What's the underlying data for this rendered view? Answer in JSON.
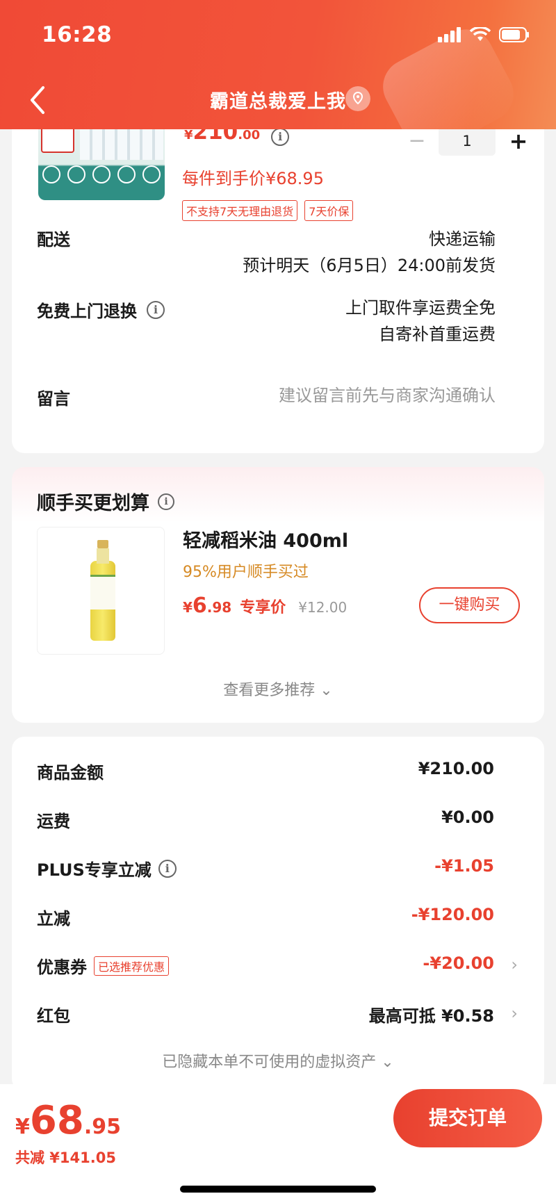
{
  "status_bar": {
    "time": "16:28"
  },
  "nav": {
    "title": "霸道总裁爱上我"
  },
  "product": {
    "price_currency": "¥",
    "price_int": "210",
    "price_dec": ".00",
    "quantity": "1",
    "each_price": "每件到手价¥68.95",
    "tags": [
      "不支持7天无理由退货",
      "7天价保"
    ]
  },
  "delivery": {
    "label": "配送",
    "method": "快递运输",
    "estimate": "预计明天（6月5日）24:00前发货"
  },
  "exchange": {
    "label": "免费上门退换",
    "line1": "上门取件享运费全免",
    "line2": "自寄补首重运费"
  },
  "message": {
    "label": "留言",
    "placeholder": "建议留言前先与商家沟通确认"
  },
  "addon": {
    "header": "顺手买更划算",
    "title": "轻减稻米油 400ml",
    "subtitle": "95%用户顺手买过",
    "price_currency": "¥",
    "price_int": "6",
    "price_dec": ".98",
    "price_label": "专享价",
    "original_price": "¥12.00",
    "buy_label": "一键购买",
    "more_label": "查看更多推荐 ⌄"
  },
  "summary": {
    "rows": [
      {
        "label": "商品金额",
        "value": "¥210.00"
      },
      {
        "label": "运费",
        "value": "¥0.00"
      },
      {
        "label": "PLUS专享立减",
        "value": "-¥1.05"
      },
      {
        "label": "立减",
        "value": "-¥120.00"
      },
      {
        "label": "优惠券",
        "tag": "已选推荐优惠",
        "value": "-¥20.00"
      },
      {
        "label": "红包",
        "value": "最高可抵 ¥0.58"
      }
    ],
    "hidden_note": "已隐藏本单不可使用的虚拟资产 ⌄"
  },
  "footer": {
    "total_currency": "¥",
    "total_int": "68",
    "total_dec": ".95",
    "saved": "共减 ¥141.05",
    "submit_label": "提交订单"
  },
  "colors": {
    "accent": "#e8412f",
    "header": "#f04a36",
    "addon_subtitle": "#d68a24"
  }
}
